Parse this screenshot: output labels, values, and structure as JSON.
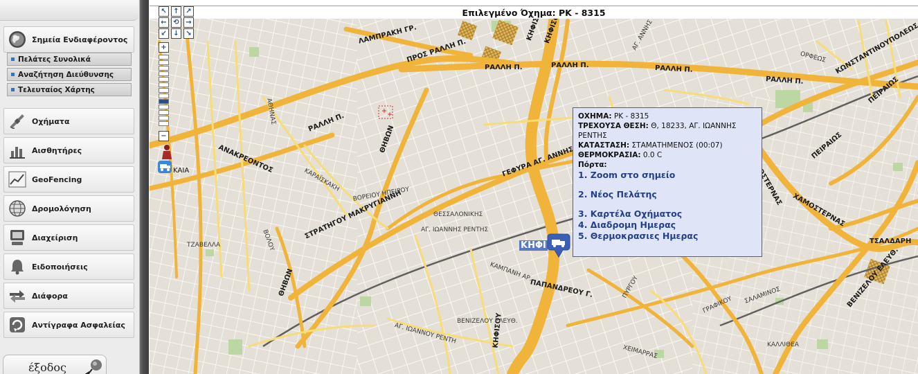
{
  "sidebar": {
    "main_item": {
      "label": "Σημεία Ενδιαφέροντος",
      "icon": "globe-icon"
    },
    "sub_items": [
      {
        "label": "Πελάτες Συνολικά"
      },
      {
        "label": "Αναζήτηση Διεύθυνσης"
      },
      {
        "label": "Τελευταίος Χάρτης"
      }
    ],
    "items": [
      {
        "label": "Οχήματα",
        "icon": "satellite-icon"
      },
      {
        "label": "Αισθητήρες",
        "icon": "bar-chart-icon"
      },
      {
        "label": "GeoFencing",
        "icon": "line-chart-icon"
      },
      {
        "label": "Δρομολόγηση",
        "icon": "globe-grid-icon"
      },
      {
        "label": "Διαχείριση",
        "icon": "computer-icon"
      },
      {
        "label": "Ειδοποιήσεις",
        "icon": "bell-icon"
      },
      {
        "label": "Διάφορα",
        "icon": "arrows-icon"
      },
      {
        "label": "Αντίγραφα Ασφαλείας",
        "icon": "backup-icon"
      }
    ],
    "logout_label": "έξοδος"
  },
  "map": {
    "title": "Επιλεγμένο Όχημα: PK - 8315",
    "vehicle_marker_label": "ΚΗΦΙ",
    "place_label_near_marker": "ΑΓ. ΙΩΑΝΝΗΣ ΡΕΝΤΗΣ",
    "nav": {
      "zoom_in": "+",
      "zoom_out": "−",
      "zoom_level_step": 8,
      "zoom_level_steps_total": 13
    },
    "labels": {
      "kaia": "ΚΑΙΑ",
      "rallh1": "ΡΑΛΛΗ Π.",
      "rallh2": "ΡΑΛΛΗ Π.",
      "rallh3": "ΡΑΛΛΗ Π.",
      "rallh4": "ΡΑΛΛΗ Π.",
      "rallh5": "ΡΑΛΛΗ Π.",
      "proslallh": "ΠΡΟΣ ΡΑΛΛΗ Π.",
      "lamprakh": "ΛΑΜΠΡΑΚΗ ΓΡ.",
      "anakreontos": "ΑΝΑΚΡΕΟΝΤΟΣ",
      "thivon1": "ΘΗΒΩΝ",
      "thivon2": "ΘΗΒΩΝ",
      "kifisou1": "ΚΗΦΙΣΟΥ",
      "kifisou2": "ΚΗΦΙΣΟΥ",
      "kifisou3": "ΚΗΦΙΣΟΥ",
      "gefyra": "ΓΕΦΥΡΑ ΑΓ. ΑΝΝΗΣ",
      "makrygianni": "ΣΤΡΑΤΗΓΟΥ ΜΑΚΡΥΓΙΑΝΝΗ",
      "papandreou": "ΠΑΠΑΝΔΡΕΟΥ Γ.",
      "xamosternas1": "ΧΑΜΟΣΤΕΡΝΑΣ",
      "xamosternas2": "ΧΑΜΟΣΤΕΡΝΑΣ",
      "peiraios1": "ΠΕΙΡΑΙΩΣ",
      "peiraios2": "ΠΕΙΡΑΙΩΣ",
      "konstantinoupoleos": "ΚΩΝΣΤΑΝΤΙΝΟΥΠΟΛΕΩΣ",
      "tsaldari": "ΤΣΑΛΔΑΡΗ",
      "venizelou": "ΒΕΝΙΖΕΛΟΥ ΕΛΕΥΘ.",
      "kallithea": "ΚΑΛΛΙΘΕΑ",
      "ag_annhs": "ΑΓ. ΑΝΝΗΣ",
      "thessalonikis": "ΘΕΣΣΑΛΟΝΙΚΗΣ",
      "tzavella": "ΤΖΑΒΕΛΛΑ",
      "voreiou": "ΒΟΡΕΙΟΥ ΗΠΕΙΡΟΥ",
      "karaiskaki": "ΚΑΡΑΪΣΚΑΚΗ",
      "venizelou_el": "ΒΕΝΙΖΕΛΟΥ ΕΛΕΥΘ.",
      "ag_ioannou": "ΑΓ. ΙΩΑΝΝΟΥ ΡΕΝΤΗ",
      "kampanh": "ΚΑΜΠΑΝΗ ΑΡ.",
      "orfeos": "ΟΡΦΕΩΣ",
      "voulou": "ΒΟΛΟΥ",
      "pyrgou": "ΠΥΡΓΟΥ",
      "xeimarras": "ΧΕΙΜΑΡΡΑΣ",
      "salaminos": "ΣΑΛΑΜΙΝΟΣ",
      "grafikou": "ΓΡΑΦΙΚΟΥ",
      "athinas": "ΑΘΗΝΑΣ"
    }
  },
  "popup": {
    "vehicle_key": "ΟΧΗΜΑ:",
    "vehicle_value": "PK - 8315",
    "position_key": "ΤΡΕΧΟΥΣΑ ΘΕΣΗ:",
    "position_value": "Θ, 18233, ΑΓ. ΙΩΑΝΝΗΣ ΡΕΝΤΗΣ",
    "status_key": "ΚΑΤΑΣΤΑΣΗ:",
    "status_value": "ΣΤΑΜΑΤΗΜΕΝΟΣ (00:07)",
    "temp_key": "ΘΕΡΜΟΚΡΑΣΙΑ:",
    "temp_value": "0.0 C",
    "door_key": "Πόρτα:",
    "links": [
      "1. Zoom στο σημείο",
      "2. Νέος Πελάτης",
      "3. Καρτέλα Οχήματος",
      "4. Διαδρομη Ημερας",
      "5. Θερμοκρασιες Ημερας"
    ]
  }
}
